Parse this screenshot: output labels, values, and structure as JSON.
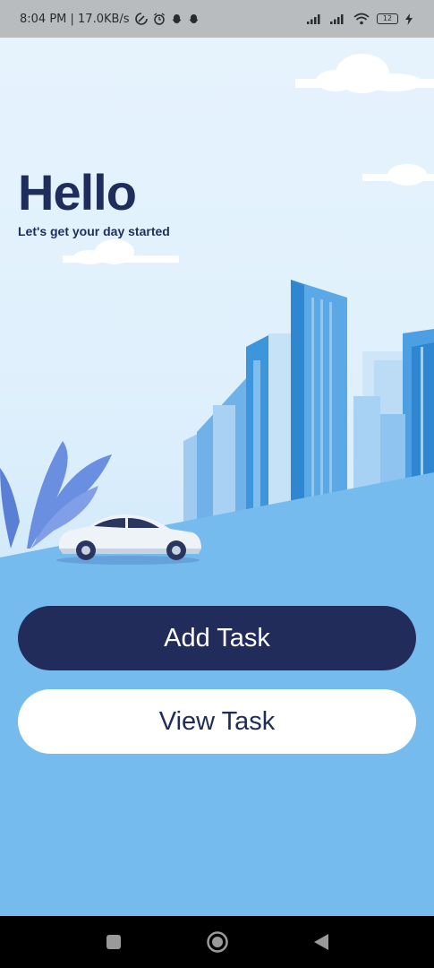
{
  "status_bar": {
    "time_speed": "8:04 PM | 17.0KB/s",
    "battery_level": "12"
  },
  "greeting": {
    "title": "Hello",
    "subtitle": "Let's get your day started"
  },
  "actions": {
    "add_label": "Add Task",
    "view_label": "View Task"
  },
  "icons": {
    "status_left": [
      "data-saver-icon",
      "alarm-icon",
      "snapchat-icon",
      "snapchat-icon"
    ],
    "status_right": [
      "signal-icon",
      "signal-icon",
      "wifi-icon",
      "battery-icon",
      "charging-icon"
    ],
    "nav": [
      "recent-apps-icon",
      "home-icon",
      "back-icon"
    ]
  },
  "colors": {
    "primary": "#222c5a",
    "sky": "#e6f3fd",
    "ground": "#76bbee",
    "building": "#4a9fe0"
  }
}
